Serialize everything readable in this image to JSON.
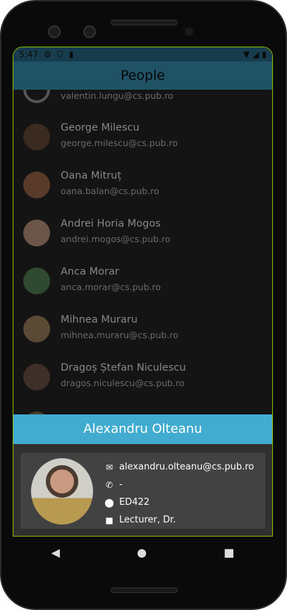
{
  "status": {
    "time": "5:47"
  },
  "header": {
    "title": "People"
  },
  "people": [
    {
      "name": "",
      "email": "valentin.lungu@cs.pub.ro"
    },
    {
      "name": "George Milescu",
      "email": "george.milescu@cs.pub.ro"
    },
    {
      "name": "Oana Mitruț",
      "email": "oana.balan@cs.pub.ro"
    },
    {
      "name": "Andrei Horia Mogos",
      "email": "andrei.mogos@cs.pub.ro"
    },
    {
      "name": "Anca Morar",
      "email": "anca.morar@cs.pub.ro"
    },
    {
      "name": "Mihnea Muraru",
      "email": "mihnea.muraru@cs.pub.ro"
    },
    {
      "name": "Dragoș Ștefan Niculescu",
      "email": "dragos.niculescu@cs.pub.ro"
    }
  ],
  "detail": {
    "name": "Alexandru Olteanu",
    "email": "alexandru.olteanu@cs.pub.ro",
    "phone": "-",
    "office": "ED422",
    "position": "Lecturer, Dr."
  },
  "colors": {
    "accent": "#41acd0",
    "header": "#205266"
  }
}
